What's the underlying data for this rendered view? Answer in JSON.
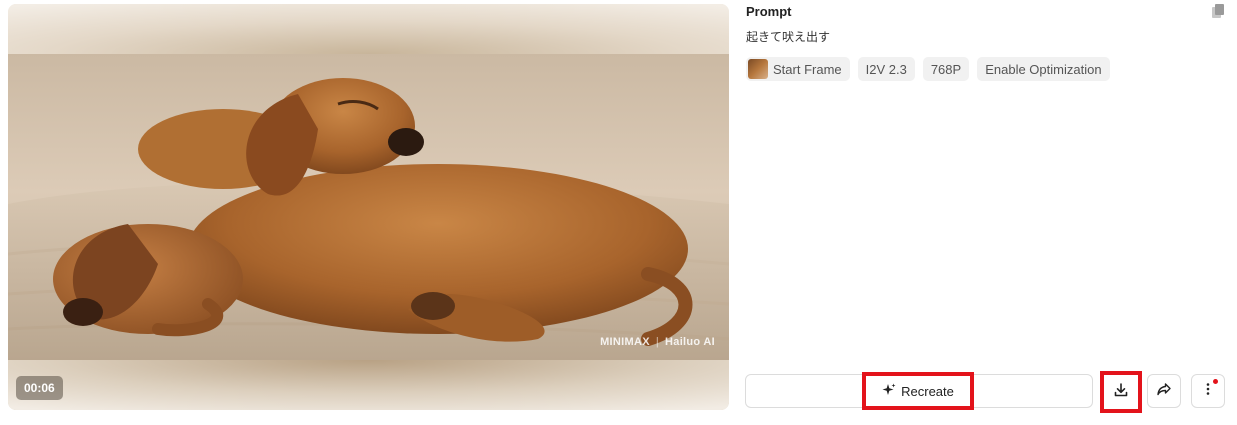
{
  "video": {
    "duration": "00:06",
    "watermark_brand": "MINIMAX",
    "watermark_separator": "|",
    "watermark_app": "Hailuo AI"
  },
  "prompt": {
    "title": "Prompt",
    "text": "起きて吠え出す",
    "copy_icon": "copy-icon"
  },
  "chips": [
    {
      "label": "Start Frame",
      "icon": "start-frame-thumbnail"
    },
    {
      "label": "I2V 2.3"
    },
    {
      "label": "768P"
    },
    {
      "label": "Enable Optimization"
    }
  ],
  "actions": {
    "recreate_label": "Recreate",
    "recreate_icon": "sparkle-icon",
    "download_icon": "download-icon",
    "share_icon": "share-icon",
    "more_icon": "more-vertical-icon",
    "highlight_color": "#e3131b"
  }
}
